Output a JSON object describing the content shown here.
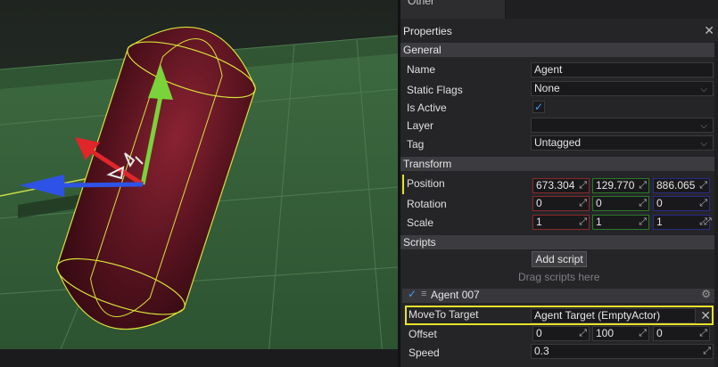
{
  "top_tab": {
    "label": "Other"
  },
  "properties": {
    "title": "Properties",
    "close_icon": "close-icon"
  },
  "general": {
    "section_label": "General",
    "name_label": "Name",
    "name_value": "Agent",
    "static_flags_label": "Static Flags",
    "static_flags_value": "None",
    "is_active_label": "Is Active",
    "is_active_checked": true,
    "layer_label": "Layer",
    "layer_value": "",
    "tag_label": "Tag",
    "tag_value": "Untagged"
  },
  "transform": {
    "section_label": "Transform",
    "position_label": "Position",
    "position": [
      "673.304",
      "129.770",
      "886.065"
    ],
    "rotation_label": "Rotation",
    "rotation": [
      "0",
      "0",
      "0"
    ],
    "scale_label": "Scale",
    "scale": [
      "1",
      "1",
      "1"
    ]
  },
  "scripts": {
    "section_label": "Scripts",
    "add_script_label": "Add script",
    "drag_hint": "Drag scripts here",
    "script_name": "Agent 007",
    "move_to_target_label": "MoveTo Target",
    "move_to_target_value": "Agent Target (EmptyActor)",
    "offset_label": "Offset",
    "offset": [
      "0",
      "100",
      "0"
    ],
    "speed_label": "Speed",
    "speed_value": "0.3"
  },
  "colors": {
    "accent": "#3b9dff",
    "highlight": "#e8e12a",
    "axis_x": "#8a2a2a",
    "axis_y": "#2a7a2a",
    "axis_z": "#2a2a8a"
  }
}
